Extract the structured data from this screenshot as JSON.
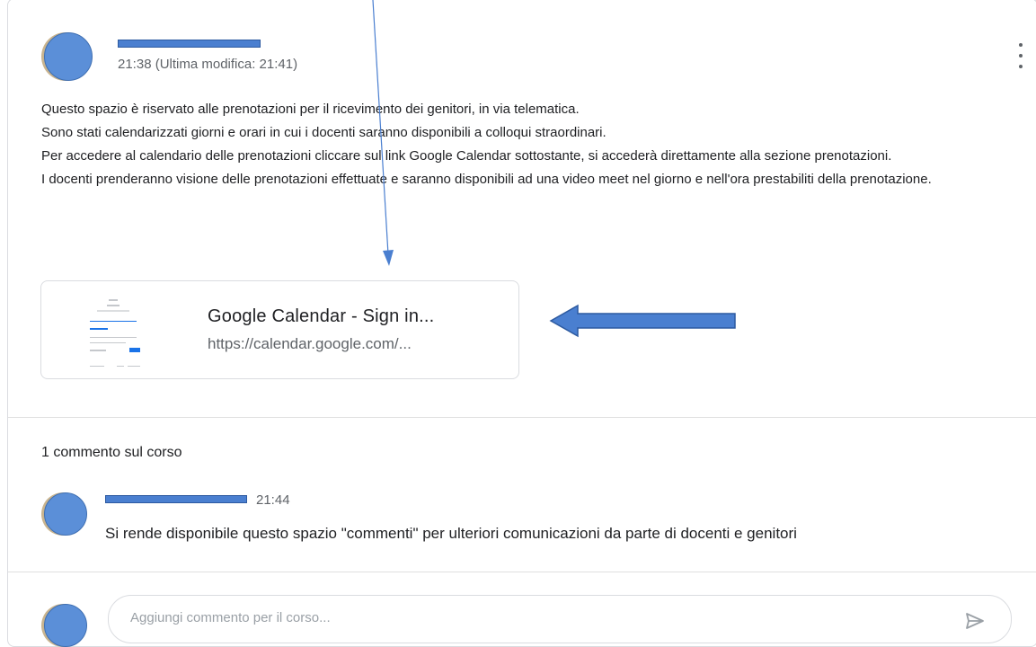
{
  "post": {
    "time": "21:38 (Ultima modifica: 21:41)",
    "body": [
      "Questo spazio è riservato alle prenotazioni per il ricevimento dei genitori, in via telematica.",
      "Sono stati calendarizzati giorni e orari in cui i docenti saranno disponibili a colloqui straordinari.",
      "Per accedere al calendario delle prenotazioni cliccare sul link Google Calendar sottostante, si accederà direttamente alla sezione prenotazioni.",
      "I docenti prenderanno visione delle prenotazioni effettuate e saranno disponibili ad una video meet nel giorno e nell'ora prestabiliti della prenotazione."
    ],
    "attachment": {
      "title": "Google Calendar - Sign in...",
      "url": "https://calendar.google.com/..."
    }
  },
  "comments": {
    "header": "1 commento sul corso",
    "items": [
      {
        "time": "21:44",
        "text": "Si rende disponibile questo spazio \"commenti\" per ulteriori comunicazioni da parte di docenti e genitori"
      }
    ],
    "input_placeholder": "Aggiungi commento per il corso..."
  },
  "icons": {
    "more": "more-vert-icon",
    "send": "send-icon"
  },
  "colors": {
    "avatar": "#5b8fd8",
    "annotation": "#4a7fd0",
    "link_blue": "#1a73e8"
  }
}
